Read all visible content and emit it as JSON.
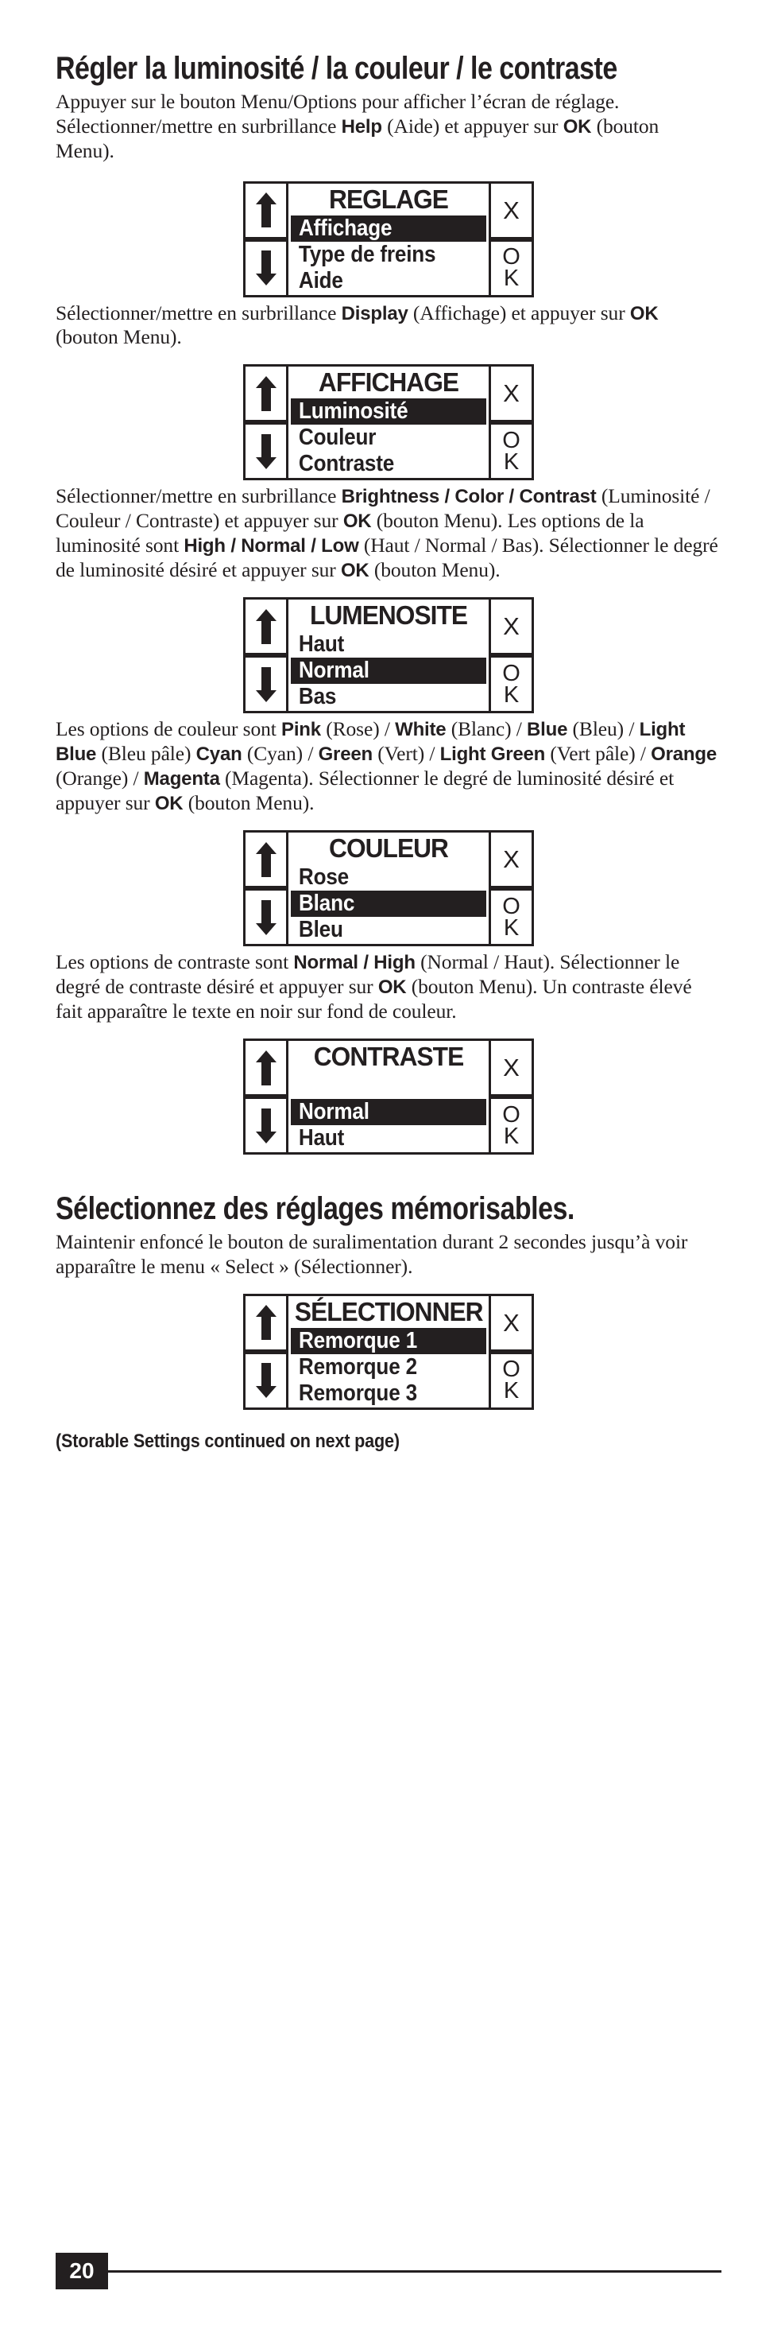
{
  "page": {
    "number": "20",
    "ink_color": "#231f20",
    "background_color": "#ffffff"
  },
  "sections": [
    {
      "heading": "Régler la luminosité / la couleur / le contraste",
      "paragraphs": [
        "Appuyer sur le bouton Menu/Options pour afficher l’écran de réglage. Sélectionner/mettre en surbrillance Help (Aide) et appuyer sur OK (bouton Menu)."
      ]
    },
    {
      "heading": "Sélectionnez des réglages mémorisables.",
      "paragraphs": [
        "Maintenir enfoncé le bouton de suralimentation durant 2 secondes jusqu’à voir apparaître le menu « Select » (Sélectionner)."
      ]
    }
  ],
  "paragraph_1": {
    "run_1": "Appuyer sur le bouton Menu/Options pour afficher l’écran de réglage. Sélectionner/mettre en surbrillance ",
    "bold_1": "Help",
    "run_2": " (Aide) et appuyer sur ",
    "bold_2": "OK",
    "run_3": " (bouton Menu)."
  },
  "paragraph_2": {
    "run_1": "Sélectionner/mettre en surbrillance ",
    "bold_1": "Display",
    "run_2": " (Affichage) et appuyer sur ",
    "bold_2": "OK",
    "run_3": " (bouton Menu)."
  },
  "paragraph_3": {
    "run_1": "Sélectionner/mettre en surbrillance ",
    "bold_1": "Brightness / Color / Contrast",
    "run_2": " (Luminosité / Couleur / Contraste) et appuyer sur ",
    "bold_2": "OK",
    "run_3": " (bouton Menu). Les options de la luminosité sont ",
    "bold_3": "High / Normal / Low",
    "run_4": " (Haut / Normal / Bas). Sélectionner le degré de luminosité désiré et appuyer sur ",
    "bold_4": "OK",
    "run_5": " (bouton Menu)."
  },
  "paragraph_4": {
    "run_1": "Les options de couleur sont ",
    "bold_1": "Pink",
    "run_2": " (Rose) / ",
    "bold_2": "White",
    "run_3": " (Blanc) / ",
    "bold_3": "Blue",
    "run_4": " (Bleu) / ",
    "bold_4": "Light Blue",
    "run_5": " (Bleu pâle) ",
    "bold_5": "Cyan",
    "run_6": " (Cyan) / ",
    "bold_6": "Green",
    "run_7": " (Vert) / ",
    "bold_7": "Light Green",
    "run_8": " (Vert pâle) / ",
    "bold_8": "Orange",
    "run_9": " (Orange) / ",
    "bold_9": "Magenta",
    "run_10": " (Magenta). Sélectionner le degré de luminosité désiré et appuyer sur ",
    "bold_10": "OK",
    "run_11": " (bouton Menu)."
  },
  "paragraph_5": {
    "run_1": "Les options de contraste sont ",
    "bold_1": "Normal / High",
    "run_2": " (Normal / Haut). Sélectionner le degré de contraste désiré et appuyer sur ",
    "bold_2": "OK",
    "run_3": " (bouton Menu). Un contraste élevé fait apparaître le texte en noir sur fond de couleur."
  },
  "paragraph_6": {
    "run_1": "Maintenir enfoncé le bouton de suralimentation durant 2 secondes jusqu’à voir apparaître le menu « Select » (Sélectionner)."
  },
  "lcd_common": {
    "up_arrow_icon": "arrow-up-icon",
    "down_arrow_icon": "arrow-down-icon",
    "cancel_label": "X",
    "ok_label_line1": "O",
    "ok_label_line2": "K"
  },
  "screens": [
    {
      "id": "reglage",
      "title": "REGLAGE",
      "rows": [
        {
          "label": "Affichage",
          "highlighted": true
        },
        {
          "label": "Type de freins",
          "highlighted": false
        },
        {
          "label": "Aide",
          "highlighted": false
        }
      ]
    },
    {
      "id": "affichage",
      "title": "AFFICHAGE",
      "rows": [
        {
          "label": "Luminosité",
          "highlighted": true
        },
        {
          "label": "Couleur",
          "highlighted": false
        },
        {
          "label": "Contraste",
          "highlighted": false
        }
      ]
    },
    {
      "id": "lumenosite",
      "title": "LUMENOSITE",
      "rows": [
        {
          "label": "Haut",
          "highlighted": false
        },
        {
          "label": "Normal",
          "highlighted": true
        },
        {
          "label": "Bas",
          "highlighted": false
        }
      ]
    },
    {
      "id": "couleur",
      "title": "COULEUR",
      "rows": [
        {
          "label": "Rose",
          "highlighted": false
        },
        {
          "label": "Blanc",
          "highlighted": true
        },
        {
          "label": "Bleu",
          "highlighted": false
        }
      ]
    },
    {
      "id": "contraste",
      "title": "CONTRASTE",
      "rows": [
        {
          "label": "",
          "highlighted": false
        },
        {
          "label": "Normal",
          "highlighted": true
        },
        {
          "label": "Haut",
          "highlighted": false
        }
      ]
    },
    {
      "id": "selectionner",
      "title": "SÉLECTIONNER",
      "rows": [
        {
          "label": "Remorque 1",
          "highlighted": true
        },
        {
          "label": "Remorque 2",
          "highlighted": false
        },
        {
          "label": "Remorque 3",
          "highlighted": false
        }
      ]
    }
  ],
  "footer": {
    "continued_note": "(Storable Settings continued on next page)"
  }
}
